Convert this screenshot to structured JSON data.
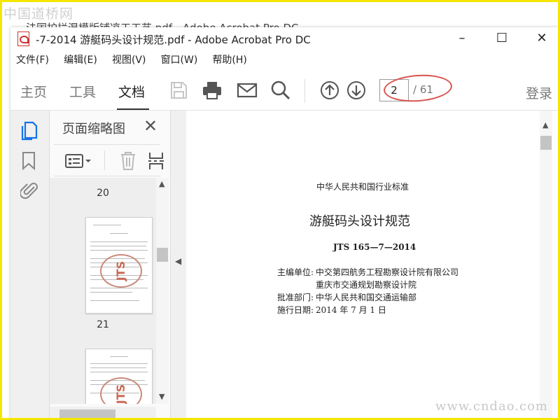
{
  "watermarks": {
    "top": "中国道桥网",
    "bottom": "www.cndao.com"
  },
  "ghost_window": {
    "title": "法国护拦混模版铺凉工工艺.pdf - Adobe Acrobat Pro DC"
  },
  "window": {
    "title": "-7-2014 游艇码头设计规范.pdf - Adobe Acrobat Pro DC",
    "controls": {
      "minimize": "–",
      "maximize": "☐",
      "close": "✕"
    }
  },
  "menu": [
    "文件(F)",
    "编辑(E)",
    "视图(V)",
    "窗口(W)",
    "帮助(H)"
  ],
  "toolbar": {
    "tabs": [
      "主页",
      "工具",
      "文档"
    ],
    "active_tab": "文档",
    "current_page": "2",
    "total_pages": "/ 61",
    "login": "登录",
    "icons": [
      "save-icon",
      "print-icon",
      "email-icon",
      "search-icon",
      "page-up-icon",
      "page-down-icon"
    ]
  },
  "left_rail": {
    "icons": [
      "page-thumbnails-icon",
      "bookmark-icon",
      "attachment-icon"
    ]
  },
  "thumbnail_panel": {
    "title": "页面缩略图",
    "close": "✕",
    "thumbnails": [
      {
        "page_number": "20"
      },
      {
        "page_number": "21",
        "stamp": "JTS"
      },
      {
        "stamp": "JTS"
      }
    ]
  },
  "document": {
    "header": "中华人民共和国行业标准",
    "title": "游艇码头设计规范",
    "code": "JTS 165—7—2014",
    "editor_label": "主编单位:",
    "editor_1": "中交第四航务工程勘察设计院有限公司",
    "editor_2": "重庆市交通规划勘察设计院",
    "approver_label": "批准部门:",
    "approver": "中华人民共和国交通运输部",
    "date_label": "施行日期:",
    "date": "2014 年 7 月 1 日"
  },
  "colors": {
    "highlight_oval": "#d9534f",
    "frame_border": "#f5e600",
    "stamp": "#c86b57"
  }
}
